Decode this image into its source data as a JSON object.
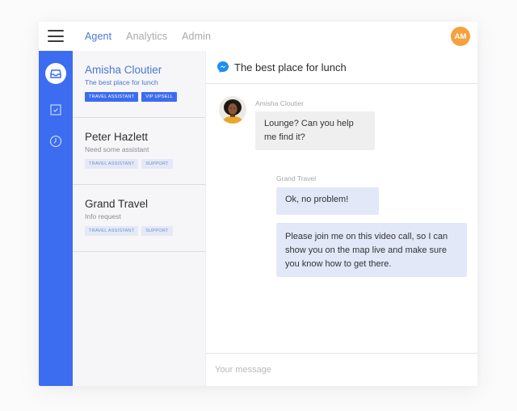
{
  "topbar": {
    "tabs": [
      {
        "label": "Agent",
        "active": true
      },
      {
        "label": "Analytics",
        "active": false
      },
      {
        "label": "Admin",
        "active": false
      }
    ],
    "user_initials": "AM",
    "avatar_color": "#f6a13e"
  },
  "rail": {
    "items": [
      {
        "icon": "inbox-icon",
        "active": true
      },
      {
        "icon": "checkbox-icon",
        "active": false
      },
      {
        "icon": "clock-icon",
        "active": false
      }
    ],
    "accent": "#3c6cf0"
  },
  "conversations": [
    {
      "name": "Amisha Cloutier",
      "subtitle": "The best place for lunch",
      "tags": [
        "TRAVEL ASSISTANT",
        "VIP UPSELL"
      ],
      "active": true
    },
    {
      "name": "Peter Hazlett",
      "subtitle": "Need some assistant",
      "tags": [
        "TRAVEL ASSISTANT",
        "SUPPORT"
      ],
      "active": false
    },
    {
      "name": "Grand Travel",
      "subtitle": "Info request",
      "tags": [
        "TRAVEL ASSISTANT",
        "SUPPORT"
      ],
      "active": false
    }
  ],
  "chat": {
    "channel_icon": "messenger-icon",
    "title": "The best place for lunch",
    "messages": [
      {
        "author": "Amisha Cloutier",
        "text": "Lounge? Can you help me find it?",
        "direction": "incoming"
      },
      {
        "author": "Grand Travel",
        "text": "Ok, no problem!",
        "direction": "outgoing"
      },
      {
        "author": "Grand Travel",
        "text": "Please join me on this video call, so I can show you on the map live and make sure you know how to get there.",
        "direction": "outgoing"
      }
    ],
    "composer_placeholder": "Your message",
    "composer_value": ""
  }
}
